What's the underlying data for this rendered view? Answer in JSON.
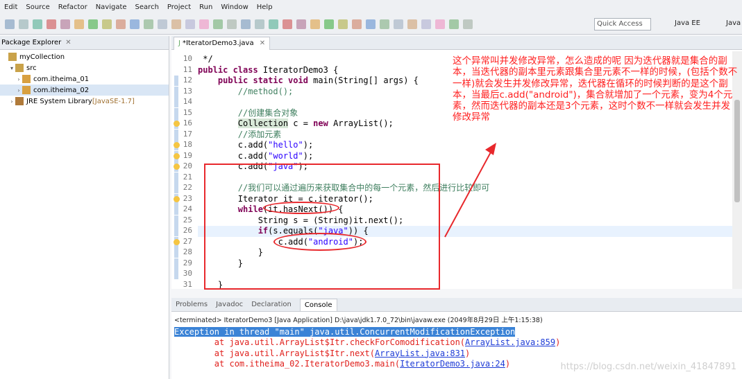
{
  "menu": [
    "Edit",
    "Source",
    "Refactor",
    "Navigate",
    "Search",
    "Project",
    "Run",
    "Window",
    "Help"
  ],
  "quick_access": "Quick Access",
  "perspectives": [
    "Java EE",
    "Java"
  ],
  "package_explorer": {
    "title": "Package Explorer",
    "items": [
      {
        "label": "myCollection",
        "indent": 0
      },
      {
        "label": "src",
        "indent": 1
      },
      {
        "label": "com.itheima_01",
        "indent": 2
      },
      {
        "label": "com.itheima_02",
        "indent": 2
      },
      {
        "label": "JRE System Library",
        "extra": "[JavaSE-1.7]",
        "indent": 1
      }
    ]
  },
  "editor": {
    "tab": "*IteratorDemo3.java",
    "lines": [
      {
        "n": "10",
        "html": " */"
      },
      {
        "n": "11",
        "html": "<span class=\"kw\">public class</span> IteratorDemo3 {"
      },
      {
        "n": "12",
        "html": "    <span class=\"kw\">public static void</span> main(String[] args) {"
      },
      {
        "n": "13",
        "html": "        <span class=\"cm\">//method();</span>"
      },
      {
        "n": "14",
        "html": ""
      },
      {
        "n": "15",
        "html": "        <span class=\"cm\">//创建集合对象</span>"
      },
      {
        "n": "16",
        "html": "        <span class=\"hl\">Collection</span> c = <span class=\"kw\">new</span> ArrayList();"
      },
      {
        "n": "17",
        "html": "        <span class=\"cm\">//添加元素</span>"
      },
      {
        "n": "18",
        "html": "        c.add(<span class=\"str\">\"hello\"</span>);"
      },
      {
        "n": "19",
        "html": "        c.add(<span class=\"str\">\"world\"</span>);"
      },
      {
        "n": "20",
        "html": "        c.add(<span class=\"str\">\"java\"</span>);"
      },
      {
        "n": "21",
        "html": ""
      },
      {
        "n": "22",
        "html": "        <span class=\"cm\">//我们可以通过遍历来获取集合中的每一个元素，然后进行比较即可</span>"
      },
      {
        "n": "23",
        "html": "        Iterator it = c.iterator();"
      },
      {
        "n": "24",
        "html": "        <span class=\"kw\">while</span>(it.hasNext()) {"
      },
      {
        "n": "25",
        "html": "            String s = (String)it.next();"
      },
      {
        "n": "26",
        "html": "            <span class=\"kw\">if</span>(s.equals(<span class=\"str\">\"java\"</span>)) {"
      },
      {
        "n": "27",
        "html": "                c.add(<span class=\"str\">\"android\"</span>);"
      },
      {
        "n": "28",
        "html": "            }"
      },
      {
        "n": "29",
        "html": "        }"
      },
      {
        "n": "30",
        "html": ""
      },
      {
        "n": "31",
        "html": "    }"
      }
    ]
  },
  "annotation": "这个异常叫并发修改异常，怎么造成的呢\n因为迭代器就是集合的副本，当迭代器的副本里元素跟集合里元素不一样的时候，(包括个数不一样)就会发生并发修改异常，迭代器在循环的时候判断的是这个副本，当最后c.add(\"android\")，集合就增加了一个元素，变为4个元素，然而迭代器的副本还是3个元素，这时个数不一样就会发生并发修改异常",
  "console": {
    "tabs": [
      "Problems",
      "Javadoc",
      "Declaration",
      "Console"
    ],
    "terminated": "<terminated> IteratorDemo3 [Java Application] D:\\java\\jdk1.7.0_72\\bin\\javaw.exe (2049年8月29日 上午1:15:38)",
    "exception": "Exception in thread \"main\" java.util.ConcurrentModificationException",
    "stack": [
      {
        "pre": "\tat java.util.ArrayList$Itr.checkForComodification(",
        "link": "ArrayList.java:859",
        "post": ")"
      },
      {
        "pre": "\tat java.util.ArrayList$Itr.next(",
        "link": "ArrayList.java:831",
        "post": ")"
      },
      {
        "pre": "\tat com.itheima_02.IteratorDemo3.main(",
        "link": "IteratorDemo3.java:24",
        "post": ")"
      }
    ]
  },
  "watermark": "https://blog.csdn.net/weixin_41847891"
}
